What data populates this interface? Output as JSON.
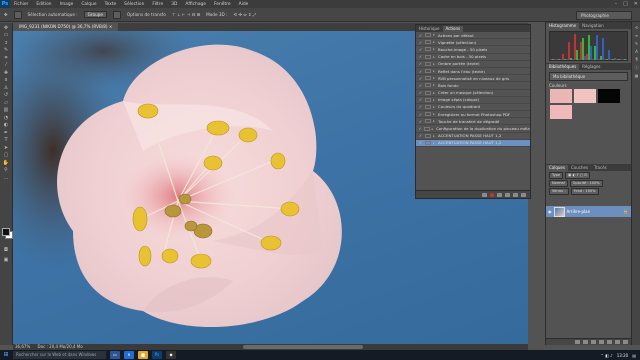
{
  "app": {
    "logo": "Ps"
  },
  "menu": [
    "Fichier",
    "Edition",
    "Image",
    "Calque",
    "Texte",
    "Sélection",
    "Filtre",
    "3D",
    "Affichage",
    "Fenêtre",
    "Aide"
  ],
  "window_controls": [
    "–",
    "□",
    "✕"
  ],
  "options": {
    "auto_select_label": "Sélection automatique :",
    "auto_select_value": "Groupe",
    "transform_label": "Options de transfo",
    "mode_3d_label": "Mode 3D :",
    "workspace": "Photographie"
  },
  "document": {
    "tab_title": "IMG_9231 (NIKON D750) @ 36,7% (RVB/8) ×",
    "zoom": "36,67%",
    "info": "Doc : 20,4 Mo/20,4 Mo"
  },
  "actions_panel": {
    "tabs": [
      "Historique",
      "Actions"
    ],
    "active_tab": "Actions",
    "items": [
      {
        "name": "Actions par défaut",
        "checked": true,
        "selected": false
      },
      {
        "name": "Vignette (sélection)",
        "checked": true,
        "selected": false
      },
      {
        "name": "Bouche-image - 50 pixels",
        "checked": true,
        "selected": false
      },
      {
        "name": "Cadre en bois - 50 pixels",
        "checked": true,
        "selected": false
      },
      {
        "name": "Ombre portée (texte)",
        "checked": true,
        "selected": false
      },
      {
        "name": "Reflet dans l'eau (texte)",
        "checked": true,
        "selected": false
      },
      {
        "name": "RVB personnalisé en niveaux de gris",
        "checked": true,
        "selected": false
      },
      {
        "name": "Bois fondu",
        "checked": true,
        "selected": false
      },
      {
        "name": "Créer un masque (sélection)",
        "checked": true,
        "selected": false
      },
      {
        "name": "Image sépia (calque)",
        "checked": true,
        "selected": false
      },
      {
        "name": "Couleurs du quadrant",
        "checked": true,
        "selected": false
      },
      {
        "name": "Enregistrer au format Photoshop PDF",
        "checked": true,
        "selected": false
      },
      {
        "name": "Touche de transfert de dégradé",
        "checked": true,
        "selected": false
      },
      {
        "name": "Configuration de la duplication du pinceau mélangeur",
        "checked": true,
        "selected": false
      },
      {
        "name": "ACCENTUATION PASSE HAUT 1,2",
        "checked": true,
        "selected": false
      },
      {
        "name": "ACCENTUATION PASSE HAUT 1,2",
        "checked": true,
        "selected": true
      }
    ]
  },
  "histogram_panel": {
    "tabs": [
      "Histogramme",
      "Navigation"
    ]
  },
  "library_panel": {
    "tabs": [
      "Bibliothèques",
      "Réglages"
    ],
    "selected_library": "Ma bibliothèque",
    "colors_label": "Couleurs",
    "swatches": [
      "#eab6b6",
      "#f3c3c3",
      "#050505",
      "#f0b8b8"
    ]
  },
  "layers_panel": {
    "tabs": [
      "Calques",
      "Couches",
      "Tracés"
    ],
    "kind_label": "Type",
    "blend_mode": "Normal",
    "opacity_label": "Opacité : 100%",
    "lock_label": "Verrou :",
    "fill_label": "Fond : 100%",
    "layer_name": "Arrière-plan"
  },
  "taskbar": {
    "search_placeholder": "Rechercher sur le Web et dans Windows",
    "time": "13:20"
  },
  "colors": {
    "selection": "#6c8fbf",
    "sky": "#3d73a6"
  }
}
